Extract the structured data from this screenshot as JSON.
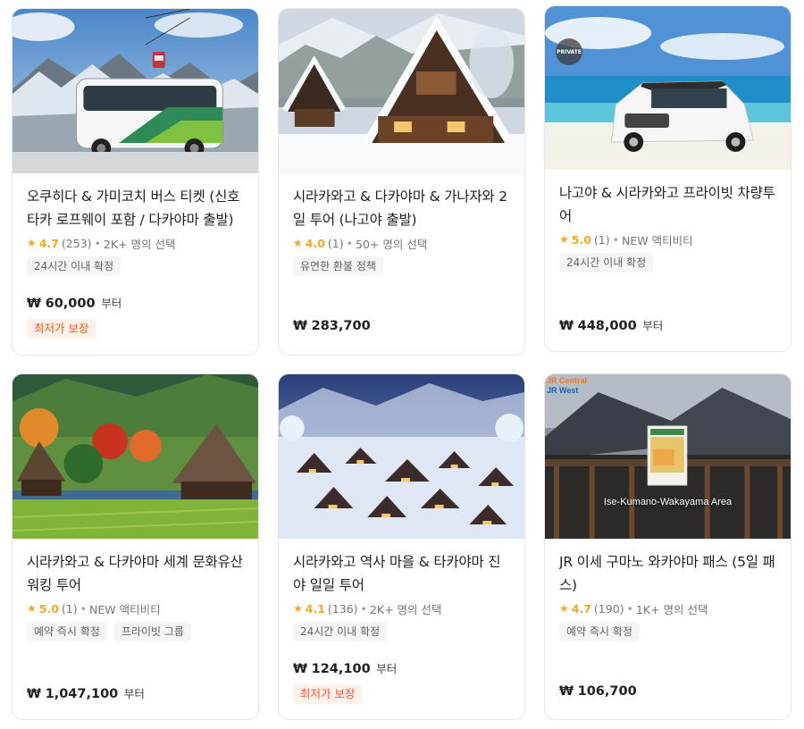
{
  "products": [
    {
      "title": "오쿠히다 & 가미코치 버스 티켓 (신호타카 로프웨이 포함 / 다카야마 출발)",
      "score": "4.7",
      "reviews": "(253)",
      "booked": "2K+ 명의 선택",
      "tags": [
        "24시간 이내 확정"
      ],
      "currency": "₩",
      "price": "60,000",
      "price_suffix": "부터",
      "badge": "최저가 보장"
    },
    {
      "title": "시라카와고 & 다카야마 & 가나자와 2일 투어 (나고야 출발)",
      "score": "4.0",
      "reviews": "(1)",
      "booked": "50+ 명의 선택",
      "tags": [
        "유연한 환불 정책"
      ],
      "currency": "₩",
      "price": "283,700",
      "price_suffix": "",
      "badge": ""
    },
    {
      "title": "나고야 & 시라카와고 프라이빗 차량투어",
      "score": "5.0",
      "reviews": "(1)",
      "booked": "NEW 액티비티",
      "tags": [
        "24시간 이내 확정"
      ],
      "currency": "₩",
      "price": "448,000",
      "price_suffix": "부터",
      "badge": "",
      "image_badge": "PRIVATE"
    },
    {
      "title": "시라카와고 & 다카야마 세계 문화유산 워킹 투어",
      "score": "5.0",
      "reviews": "(1)",
      "booked": "NEW 액티비티",
      "tags": [
        "예약 즉시 확정",
        "프라이빗 그룹"
      ],
      "currency": "₩",
      "price": "1,047,100",
      "price_suffix": "부터",
      "badge": ""
    },
    {
      "title": "시라카와고 역사 마을 & 타카야마 진야 일일 투어",
      "score": "4.1",
      "reviews": "(136)",
      "booked": "2K+ 명의 선택",
      "tags": [
        "24시간 이내 확정"
      ],
      "currency": "₩",
      "price": "124,100",
      "price_suffix": "부터",
      "badge": "최저가 보장"
    },
    {
      "title": "JR 이세 구마노 와카야마 패스 (5일 패스)",
      "score": "4.7",
      "reviews": "(190)",
      "booked": "1K+ 명의 선택",
      "tags": [
        "예약 즉시 확정"
      ],
      "currency": "₩",
      "price": "106,700",
      "price_suffix": "",
      "badge": "",
      "image_caption": "Ise-Kumano-Wakayama Area",
      "image_logo_top": "JR Central",
      "image_logo_bottom": "JR West"
    }
  ],
  "colors": {
    "star": "#f5a623",
    "badge_text": "#ff5722",
    "badge_bg": "#fff1eb",
    "tag_bg": "#f5f5f5"
  }
}
